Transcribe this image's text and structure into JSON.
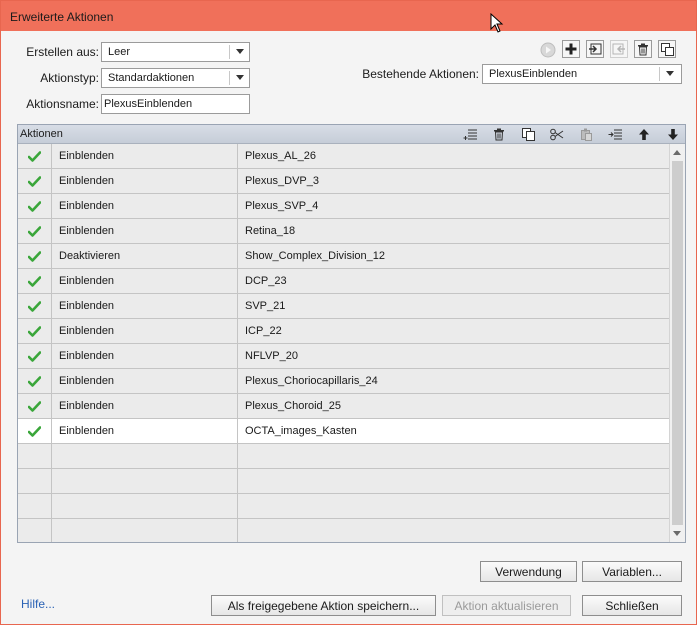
{
  "window": {
    "title": "Erweiterte Aktionen"
  },
  "form": {
    "create_from_label": "Erstellen aus:",
    "create_from_value": "Leer",
    "action_type_label": "Aktionstyp:",
    "action_type_value": "Standardaktionen",
    "action_name_label": "Aktionsname:",
    "action_name_value": "PlexusEinblenden",
    "existing_label": "Bestehende Aktionen:",
    "existing_value": "PlexusEinblenden"
  },
  "toolbar_icons": [
    "preview-icon",
    "add-icon",
    "import-icon",
    "export-icon",
    "delete-icon",
    "duplicate-icon"
  ],
  "panel": {
    "title": "Aktionen",
    "header_icons": [
      "add-row-icon",
      "trash-icon",
      "copy-icon",
      "cut-icon",
      "paste-icon",
      "insert-row-icon",
      "move-up-icon",
      "move-down-icon"
    ]
  },
  "rows": [
    {
      "checked": true,
      "action": "Einblenden",
      "target": "Plexus_AL_26"
    },
    {
      "checked": true,
      "action": "Einblenden",
      "target": "Plexus_DVP_3"
    },
    {
      "checked": true,
      "action": "Einblenden",
      "target": "Plexus_SVP_4"
    },
    {
      "checked": true,
      "action": "Einblenden",
      "target": "Retina_18"
    },
    {
      "checked": true,
      "action": "Deaktivieren",
      "target": "Show_Complex_Division_12"
    },
    {
      "checked": true,
      "action": "Einblenden",
      "target": "DCP_23"
    },
    {
      "checked": true,
      "action": "Einblenden",
      "target": "SVP_21"
    },
    {
      "checked": true,
      "action": "Einblenden",
      "target": "ICP_22"
    },
    {
      "checked": true,
      "action": "Einblenden",
      "target": "NFLVP_20"
    },
    {
      "checked": true,
      "action": "Einblenden",
      "target": "Plexus_Choriocapillaris_24"
    },
    {
      "checked": true,
      "action": "Einblenden",
      "target": "Plexus_Choroid_25"
    },
    {
      "checked": true,
      "action": "Einblenden",
      "target": "OCTA_images_Kasten",
      "selected": true
    },
    {
      "checked": false,
      "action": "",
      "target": ""
    },
    {
      "checked": false,
      "action": "",
      "target": ""
    },
    {
      "checked": false,
      "action": "",
      "target": ""
    },
    {
      "checked": false,
      "action": "",
      "target": ""
    }
  ],
  "buttons": {
    "usage": "Verwendung",
    "variables": "Variablen...",
    "save_shared": "Als freigegebene Aktion speichern...",
    "update": "Aktion aktualisieren",
    "close": "Schließen"
  },
  "help_link": "Hilfe...",
  "colors": {
    "titlebar": "#f0705a",
    "check": "#3aa63a",
    "link": "#2a62b5"
  }
}
